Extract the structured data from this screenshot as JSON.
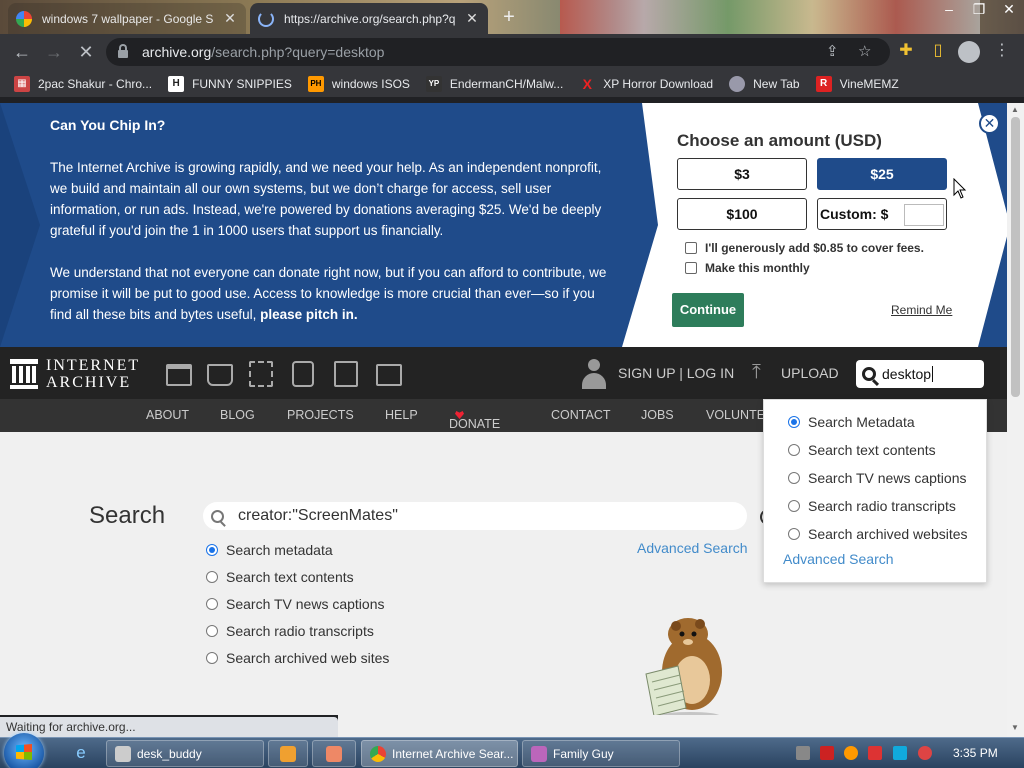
{
  "browser": {
    "tabs": [
      {
        "title": "windows 7 wallpaper - Google S",
        "active": false
      },
      {
        "title": "https://archive.org/search.php?q",
        "active": true
      }
    ],
    "url": {
      "host": "archive.org",
      "path": "/search.php?query=desktop"
    },
    "bookmarks": [
      {
        "label": "2pac Shakur - Chro...",
        "icon": "calendar-icon",
        "color": "#c44"
      },
      {
        "label": "FUNNY SNIPPIES",
        "icon": "H",
        "color": "#222"
      },
      {
        "label": "windows ISOS",
        "icon": "PH",
        "color": "#f90"
      },
      {
        "label": "EndermanCH/Malw...",
        "icon": "YP",
        "color": "#333"
      },
      {
        "label": "XP Horror Download",
        "icon": "X",
        "color": "#e22"
      },
      {
        "label": "New Tab",
        "icon": "globe-icon",
        "color": "#88a"
      },
      {
        "label": "VineMEMZ",
        "icon": "R",
        "color": "#d22"
      }
    ],
    "status": "Waiting for archive.org..."
  },
  "banner": {
    "heading": "Can You Chip In?",
    "para1": "The Internet Archive is growing rapidly, and we need your help. As an independent nonprofit, we build and maintain all our own systems, but we don’t charge for access, sell user information, or run ads. Instead, we're powered by donations averaging $25. We'd be deeply grateful if you'd join the 1 in 1000 users that support us financially.",
    "para2_start": "We understand that not everyone can donate right now, but if you can afford to contribute, we promise it will be put to good use. Access to knowledge is more crucial than ever—so if you find all these bits and bytes useful,",
    "para2_bold": "please pitch in.",
    "choose": "Choose an amount (USD)",
    "amounts": [
      "$3",
      "$25",
      "$100"
    ],
    "selected_amount": "$25",
    "custom_label": "Custom: $",
    "fees_label": "I'll generously add $0.85 to cover fees.",
    "monthly_label": "Make this monthly",
    "continue_label": "Continue",
    "remind_label": "Remind Me",
    "close_symbol": "✕"
  },
  "ia_nav": {
    "logo_line1": "INTERNET",
    "logo_line2": "ARCHIVE",
    "media_icons": [
      "web-icon",
      "texts-icon",
      "video-icon",
      "audio-icon",
      "software-icon",
      "images-icon"
    ],
    "signup": "SIGN UP | LOG IN",
    "upload": "UPLOAD",
    "search_value": "desktop",
    "sub_links": [
      "ABOUT",
      "BLOG",
      "PROJECTS",
      "HELP",
      "DONATE",
      "CONTACT",
      "JOBS",
      "VOLUNTE"
    ]
  },
  "dropdown": {
    "options": [
      "Search Metadata",
      "Search text contents",
      "Search TV news captions",
      "Search radio transcripts",
      "Search archived websites"
    ],
    "selected": "Search Metadata",
    "advanced": "Advanced Search"
  },
  "search_page": {
    "title": "Search",
    "query": "creator:\"ScreenMates\"",
    "options": [
      "Search metadata",
      "Search text contents",
      "Search TV news captions",
      "Search radio transcripts",
      "Search archived web sites"
    ],
    "selected": "Search metadata",
    "advanced": "Advanced Search"
  },
  "taskbar": {
    "tasks": [
      {
        "label": "desk_buddy",
        "active": false
      },
      {
        "label": "",
        "active": false
      },
      {
        "label": "Internet Archive Sear...",
        "active": true
      },
      {
        "label": "Family Guy",
        "active": false
      }
    ],
    "clock": "3:35 PM"
  }
}
